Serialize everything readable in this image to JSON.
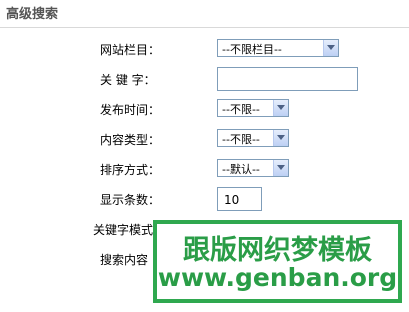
{
  "header": {
    "title": "高级搜索"
  },
  "form": {
    "column": {
      "label": "网站栏目：",
      "selected": "--不限栏目--"
    },
    "keyword": {
      "label": "关 键 字：",
      "value": ""
    },
    "publish_time": {
      "label": "发布时间：",
      "selected": "--不限--"
    },
    "content_type": {
      "label": "内容类型：",
      "selected": "--不限--"
    },
    "sort": {
      "label": "排序方式：",
      "selected": "--默认--"
    },
    "display_count": {
      "label": "显示条数：",
      "value": "10"
    },
    "keyword_mode": {
      "label": "关键字模式"
    },
    "search_content": {
      "label": "搜索内容"
    }
  },
  "watermark": {
    "line1": "跟版网织梦模板",
    "line2": "www.genban.org"
  }
}
